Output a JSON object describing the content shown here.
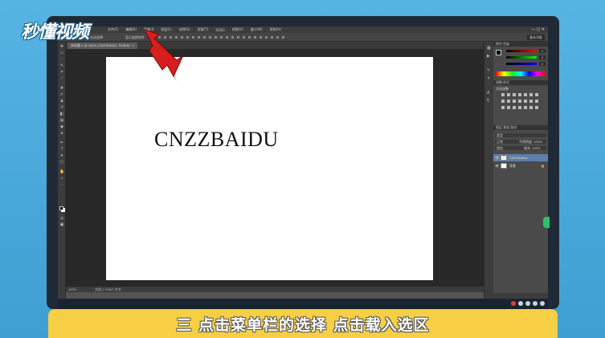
{
  "brand": {
    "logo_text": "秒懂视频"
  },
  "photoshop": {
    "menu": [
      "文件(F)",
      "编辑(E)",
      "图像(I)",
      "图层(L)",
      "选择(S)",
      "滤镜(T)",
      "3D(D)",
      "视图(V)",
      "窗口(W)",
      "帮助(H)"
    ],
    "window_controls": "— ▢ ✕",
    "options": {
      "tool_label": "自动选择:",
      "transform_label": "显示变换控件",
      "workspace": "基本功能"
    },
    "document_tab": "未标题-1 @ 100% (CNZZBAIDU, RGB/8) * ×",
    "canvas_text": "CNZZBAIDU",
    "status": {
      "zoom": "100%",
      "doc_info": "文档:1.37M/0 字节"
    },
    "panels": {
      "color_head": "颜色  色板",
      "color_values": [
        "0",
        "0",
        "0"
      ],
      "adjust_head": "调整  样式",
      "adjust_title": "添加调整",
      "layers_head": "图层  通道  路径",
      "kind_label": "类型",
      "blend_mode": "正常",
      "opacity": "不透明度: 100%",
      "lock_label": "锁定:",
      "fill": "填充: 100%",
      "layers": [
        {
          "name": "CNZZBAIDU",
          "thumb": "T",
          "active": true
        },
        {
          "name": "背景",
          "thumb": "",
          "active": false
        }
      ]
    }
  },
  "subtitle": "三 点击菜单栏的选择 点击载入选区",
  "colors": {
    "arrow": "#d81e1e",
    "subtitle_bg": "#f6cf45",
    "frame_bg": "#1f2a36"
  }
}
